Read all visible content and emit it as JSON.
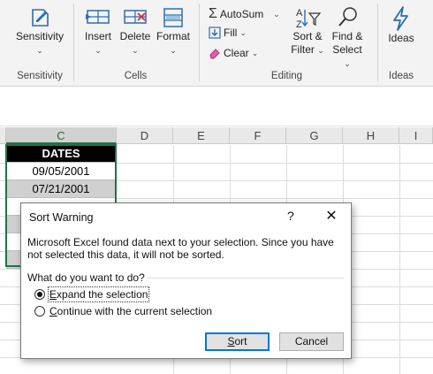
{
  "ribbon": {
    "sensitivity": {
      "label": "Sensitivity",
      "group": "Sensitivity"
    },
    "cells": {
      "insert": "Insert",
      "delete": "Delete",
      "format": "Format",
      "group": "Cells"
    },
    "editing": {
      "autosum": "AutoSum",
      "fill": "Fill",
      "clear": "Clear",
      "sort_filter_1": "Sort &",
      "sort_filter_2": "Filter",
      "find_select_1": "Find &",
      "find_select_2": "Select",
      "group": "Editing"
    },
    "ideas": {
      "label": "Ideas",
      "group": "Ideas"
    },
    "icon_color": "#2b6cb0",
    "accent_green": "#217346"
  },
  "grid": {
    "columns": [
      "C",
      "D",
      "E",
      "F",
      "G",
      "H",
      "I"
    ],
    "selected_column": "C",
    "cells": [
      {
        "text": "DATES",
        "style": "header"
      },
      {
        "text": "09/05/2001",
        "style": "white"
      },
      {
        "text": "07/21/2001",
        "style": "gray"
      },
      {
        "text": "",
        "style": "white"
      },
      {
        "text": "",
        "style": "gray"
      },
      {
        "text": "",
        "style": "white"
      },
      {
        "text": "",
        "style": "gray"
      }
    ]
  },
  "dialog": {
    "title": "Sort Warning",
    "help": "?",
    "close": "✕",
    "message": "Microsoft Excel found data next to your selection.  Since you have not selected this data, it will not be sorted.",
    "question": "What do you want to do?",
    "options": [
      {
        "label": "Expand the selection",
        "underline_char": "E",
        "rest": "xpand the selection",
        "selected": true
      },
      {
        "label": "Continue with the current selection",
        "underline_char": "C",
        "rest": "ontinue with the current selection",
        "selected": false
      }
    ],
    "sort_button": {
      "underline_char": "S",
      "rest": "ort"
    },
    "cancel_button": "Cancel"
  }
}
